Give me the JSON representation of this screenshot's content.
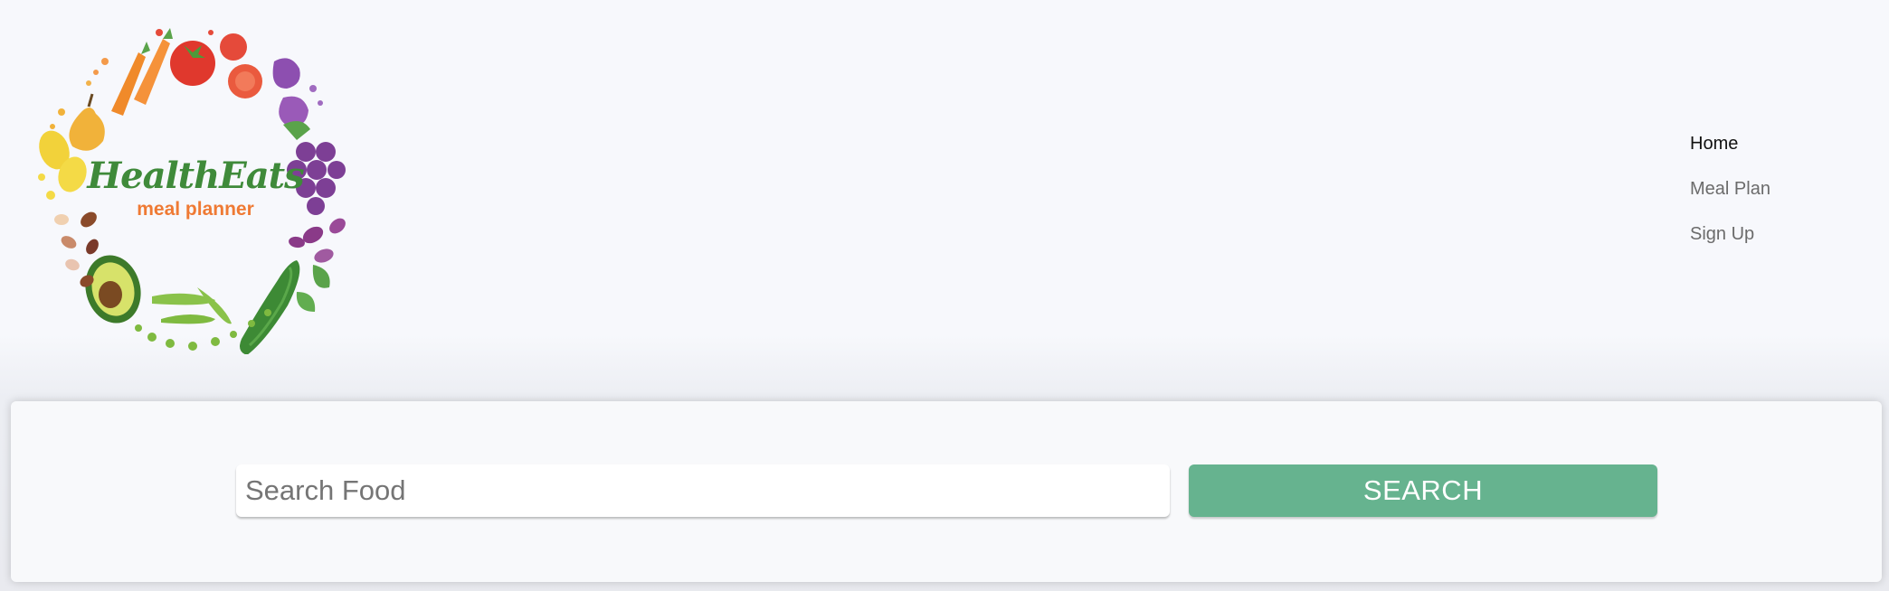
{
  "logo": {
    "brand": "HealthEats",
    "tagline": "meal planner",
    "icon": "vegetable-wreath-logo"
  },
  "nav": {
    "items": [
      {
        "label": "Home",
        "active": true
      },
      {
        "label": "Meal Plan",
        "active": false
      },
      {
        "label": "Sign Up",
        "active": false
      }
    ]
  },
  "search": {
    "placeholder": "Search Food",
    "value": "",
    "button_label": "SEARCH"
  },
  "colors": {
    "background": "#f7f8fc",
    "accent": "#66b38f",
    "brand_green": "#3f8a3a",
    "brand_orange": "#ef7a34",
    "nav_active": "#111111",
    "nav_inactive": "#6b6b6b"
  }
}
